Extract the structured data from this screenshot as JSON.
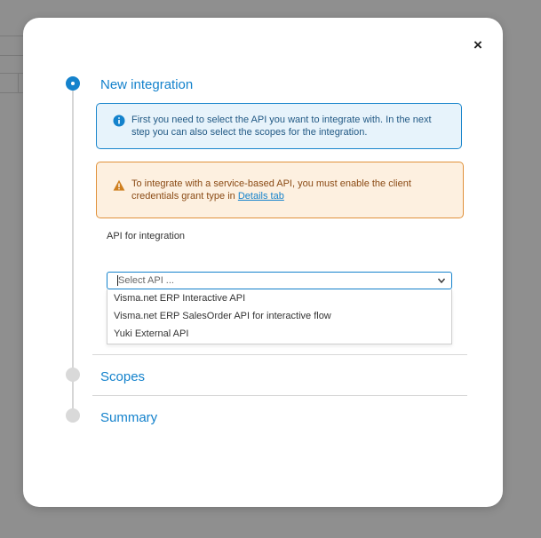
{
  "dialog": {
    "close_glyph": "×",
    "steps": [
      {
        "label": "New integration",
        "state": "active"
      },
      {
        "label": "Scopes",
        "state": "inactive"
      },
      {
        "label": "Summary",
        "state": "inactive"
      }
    ],
    "info_message": "First you need to select the API you want to integrate with. In the next step you can also select the scopes for the integration.",
    "warning_message_prefix": "To integrate with a service-based API, you must enable the client credentials grant type in ",
    "warning_link": "Details tab",
    "field_label": "API for integration",
    "select": {
      "placeholder": "Select API ...",
      "options": [
        "Visma.net ERP Interactive API",
        "Visma.net ERP SalesOrder API for interactive flow",
        "Yuki External API"
      ]
    }
  },
  "colors": {
    "accent": "#1482cc",
    "info_bg": "#e7f3fb",
    "warning_border": "#e0913a",
    "warning_bg": "#fdf0e0"
  },
  "icons": {
    "close": "close-icon",
    "info": "info-icon",
    "warning": "warning-icon",
    "chevron": "chevron-down-icon"
  }
}
